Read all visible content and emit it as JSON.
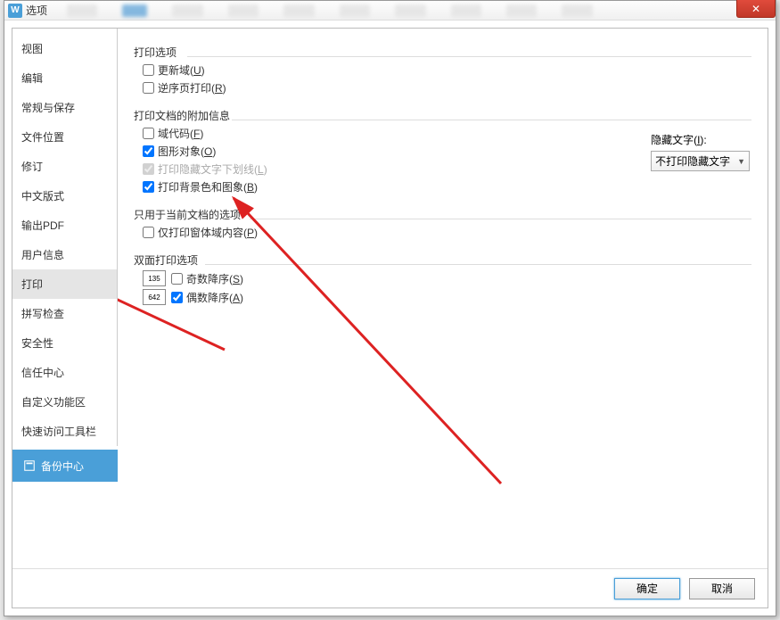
{
  "titlebar": {
    "title": "选项",
    "appicon": "W"
  },
  "sidebar": {
    "items": [
      {
        "label": "视图"
      },
      {
        "label": "编辑"
      },
      {
        "label": "常规与保存"
      },
      {
        "label": "文件位置"
      },
      {
        "label": "修订"
      },
      {
        "label": "中文版式"
      },
      {
        "label": "输出PDF"
      },
      {
        "label": "用户信息"
      },
      {
        "label": "打印"
      },
      {
        "label": "拼写检查"
      },
      {
        "label": "安全性"
      },
      {
        "label": "信任中心"
      },
      {
        "label": "自定义功能区"
      },
      {
        "label": "快速访问工具栏"
      }
    ],
    "selected_index": 8,
    "backup_label": "备份中心"
  },
  "panel": {
    "sections": {
      "print_options": {
        "title": "打印选项",
        "items": [
          {
            "label": "更新域",
            "accel": "U",
            "checked": false
          },
          {
            "label": "逆序页打印",
            "accel": "R",
            "checked": false
          }
        ]
      },
      "attach_info": {
        "title": "打印文档的附加信息",
        "items": [
          {
            "label": "域代码",
            "accel": "F",
            "checked": false
          },
          {
            "label": "图形对象",
            "accel": "O",
            "checked": true
          },
          {
            "label": "打印隐藏文字下划线",
            "accel": "L",
            "checked": true,
            "disabled": true
          },
          {
            "label": "打印背景色和图象",
            "accel": "B",
            "checked": true
          }
        ],
        "hidden_text": {
          "label": "隐藏文字",
          "accel": "I",
          "value": "不打印隐藏文字"
        }
      },
      "current_doc": {
        "title": "只用于当前文档的选项",
        "items": [
          {
            "label": "仅打印窗体域内容",
            "accel": "P",
            "checked": false
          }
        ]
      },
      "duplex": {
        "title": "双面打印选项",
        "items": [
          {
            "label": "奇数降序",
            "accel": "S",
            "checked": false,
            "icon": "135"
          },
          {
            "label": "偶数降序",
            "accel": "A",
            "checked": true,
            "icon": "642"
          }
        ]
      }
    }
  },
  "footer": {
    "ok": "确定",
    "cancel": "取消"
  }
}
